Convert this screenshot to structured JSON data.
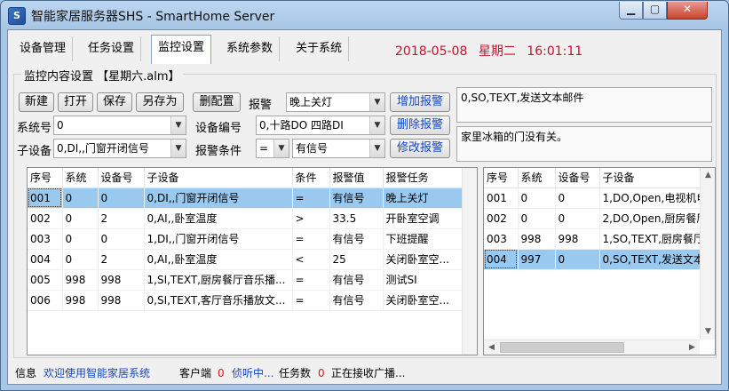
{
  "window": {
    "title": "智能家居服务器SHS - SmartHome Server",
    "icon_glyph": "S",
    "minimize_glyph": "▁",
    "maximize_glyph": "▢",
    "close_glyph": "✕"
  },
  "tabs": [
    {
      "label": "设备管理",
      "active": false
    },
    {
      "label": "任务设置",
      "active": false
    },
    {
      "label": "监控设置",
      "active": true
    },
    {
      "label": "系统参数",
      "active": false
    },
    {
      "label": "关于系统",
      "active": false
    }
  ],
  "datetime": {
    "date": "2018-05-08",
    "weekday": "星期二",
    "time": "16:01:11",
    "color": "#c8102e"
  },
  "group": {
    "title": "监控内容设置 【星期六.alm】"
  },
  "toolbar": {
    "new_label": "新建",
    "open_label": "打开",
    "save_label": "保存",
    "save_as_label": "另存为",
    "delete_config_label": "删配置",
    "alarm_label": "报警",
    "alarm_value": "晚上关灯",
    "add_alarm_label": "增加报警",
    "delete_alarm_label": "删除报警",
    "modify_alarm_label": "修改报警"
  },
  "form": {
    "system_no_label": "系统号",
    "system_no_value": "0",
    "device_no_label": "设备编号",
    "device_no_value": "0,十路DO 四路DI",
    "sub_device_label": "子设备",
    "sub_device_value": "0,DI,,门窗开闭信号",
    "alarm_condition_label": "报警条件",
    "condition_operator": "=",
    "condition_value": "有信号",
    "dropdown_arrow": "▼"
  },
  "memo": {
    "task_text": "0,SO,TEXT,发送文本邮件",
    "message_text": "家里冰箱的门没有关。"
  },
  "monitor_table": {
    "columns": [
      "序号",
      "系统",
      "设备号",
      "子设备",
      "条件",
      "报警值",
      "报警任务"
    ],
    "rows": [
      [
        "001",
        "0",
        "0",
        "0,DI,,门窗开闭信号",
        "=",
        "有信号",
        "晚上关灯"
      ],
      [
        "002",
        "0",
        "2",
        "0,AI,,卧室温度",
        ">",
        "33.5",
        "开卧室空调"
      ],
      [
        "003",
        "0",
        "0",
        "1,DI,,门窗开闭信号",
        "=",
        "有信号",
        "下班提醒"
      ],
      [
        "004",
        "0",
        "2",
        "0,AI,,卧室温度",
        "<",
        "25",
        "关闭卧室空..."
      ],
      [
        "005",
        "998",
        "998",
        "1,SI,TEXT,厨房餐厅音乐播...",
        "=",
        "有信号",
        "测试SI"
      ],
      [
        "006",
        "998",
        "998",
        "0,SI,TEXT,客厅音乐播放文...",
        "=",
        "有信号",
        "关闭卧室空..."
      ]
    ],
    "selected_index": 0
  },
  "task_table": {
    "columns": [
      "序号",
      "系统",
      "设备号",
      "子设备"
    ],
    "rows": [
      [
        "001",
        "0",
        "0",
        "1,DO,Open,电视机电"
      ],
      [
        "002",
        "0",
        "0",
        "2,DO,Open,厨房餐厅"
      ],
      [
        "003",
        "998",
        "998",
        "1,SO,TEXT,厨房餐厅"
      ],
      [
        "004",
        "997",
        "0",
        "0,SO,TEXT,发送文本"
      ]
    ],
    "selected_index": 3
  },
  "scroll": {
    "up": "▲",
    "down": "▼",
    "left": "◀",
    "right": "▶"
  },
  "status": {
    "info_label": "信息",
    "info_text": "欢迎使用智能家居系统",
    "clients_label": "客户端",
    "clients_count": "0",
    "listening_text": "侦听中...",
    "tasks_label": "任务数",
    "tasks_count": "0",
    "broadcast_text": "正在接收广播..."
  }
}
